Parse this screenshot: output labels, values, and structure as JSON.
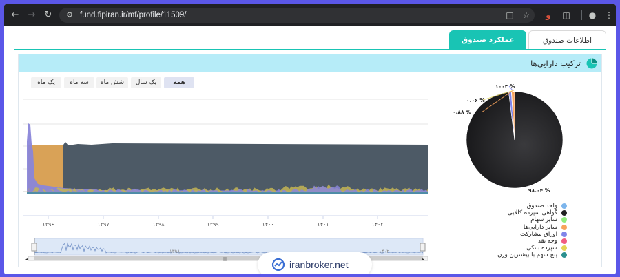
{
  "browser": {
    "url": "fund.fipiran.ir/mf/profile/11509/",
    "icons": [
      "back-icon",
      "forward-icon",
      "reload-icon",
      "site-info-icon",
      "cast-icon",
      "star-icon",
      "extension-icon",
      "puzzle-icon",
      "profile-icon",
      "menu-icon"
    ]
  },
  "tabs": [
    {
      "label": "اطلاعات صندوق"
    },
    {
      "label": "عملکرد صندوق"
    }
  ],
  "panel": {
    "title": "ترکیب دارایی‌ها"
  },
  "range_buttons": [
    {
      "label": "همه"
    },
    {
      "label": "یک سال"
    },
    {
      "label": "شش ماه"
    },
    {
      "label": "سه ماه"
    },
    {
      "label": "یک ماه"
    }
  ],
  "time_axis": {
    "ticks": [
      "۱۳۹۶",
      "۱۳۹۷",
      "۱۳۹۸",
      "۱۳۹۹",
      "۱۴۰۰",
      "۱۴۰۱",
      "۱۴۰۲"
    ],
    "navigator_ticks": [
      "۱۳۹۸",
      "۱۴۰۲"
    ]
  },
  "pie": {
    "labels": [
      "۱۰۰۲ %",
      "۰.۰۶ %",
      "۰.۸۸ %",
      "۹۸.۰۴ %"
    ]
  },
  "legend": [
    {
      "label": "واحد صندوق",
      "color": "#7cb5ec"
    },
    {
      "label": "گواهی سپرده کالایی",
      "color": "#222222"
    },
    {
      "label": "سایر سهام",
      "color": "#90ed7d"
    },
    {
      "label": "سایر دارایی‌ها",
      "color": "#f7a35c"
    },
    {
      "label": "اوراق مشارکت",
      "color": "#8085e9"
    },
    {
      "label": "وجه نقد",
      "color": "#f15c80"
    },
    {
      "label": "سپرده بانکی",
      "color": "#e4d354"
    },
    {
      "label": "پنج سهم با بیشترین وزن",
      "color": "#2b908f"
    }
  ],
  "chart_data": [
    {
      "type": "area",
      "series": [
        {
          "name": "گواهی سپرده کالایی",
          "color": "#4d5a66"
        },
        {
          "name": "سایر دارایی‌ها",
          "color": "#d9a257"
        },
        {
          "name": "اوراق مشارکت",
          "color": "#8a86d9"
        },
        {
          "name": "سپرده بانکی",
          "color": "#e4d354"
        }
      ],
      "x_ticks": [
        "۱۳۹۶",
        "۱۳۹۷",
        "۱۳۹۸",
        "۱۳۹۹",
        "۱۴۰۰",
        "۱۴۰۱",
        "۱۴۰۲"
      ]
    },
    {
      "type": "pie",
      "slices": [
        {
          "name": "گواهی سپرده کالایی",
          "value": 98.04,
          "color": "#222222",
          "label": "۹۸.۰۴ %"
        },
        {
          "name": "اوراق مشارکت",
          "value": 0.88,
          "color": "#8085e9",
          "label": "۰.۸۸ %"
        },
        {
          "name": "سپرده بانکی",
          "value": 0.06,
          "color": "#e4d354",
          "label": "۰.۰۶ %"
        },
        {
          "name": "سایر دارایی‌ها",
          "value": 1.02,
          "color": "#f7a35c",
          "label": "۱۰۰۲ %"
        }
      ]
    }
  ],
  "watermark": {
    "text": "iranbroker.net"
  }
}
